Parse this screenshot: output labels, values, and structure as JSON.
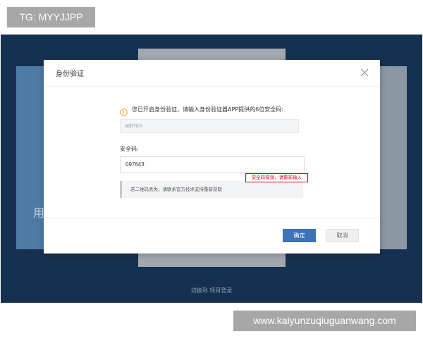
{
  "watermarks": {
    "top": "TG: MYYJJPP",
    "bottom": "www.kaiyunzuqiuguanwang.com"
  },
  "background": {
    "partial_text": "用",
    "footer_link": "切换到 项目登录"
  },
  "modal": {
    "title": "身份验证",
    "hint": "您已开启身份验证，请输入身份验证器APP提供的6位安全码:",
    "username_value": "admin",
    "code_label": "安全码:",
    "code_value": "097643",
    "error_message": "安全码错误，请重新输入",
    "notice": "若二维码丢失，请联系官方技术支持重新获取",
    "confirm_label": "确定",
    "cancel_label": "取消"
  },
  "colors": {
    "primary": "#3f73b9",
    "error": "#d0021b",
    "warning": "#f0a020",
    "backdrop": "#163150"
  },
  "icons": {
    "close": "close-icon",
    "info": "info-icon"
  }
}
